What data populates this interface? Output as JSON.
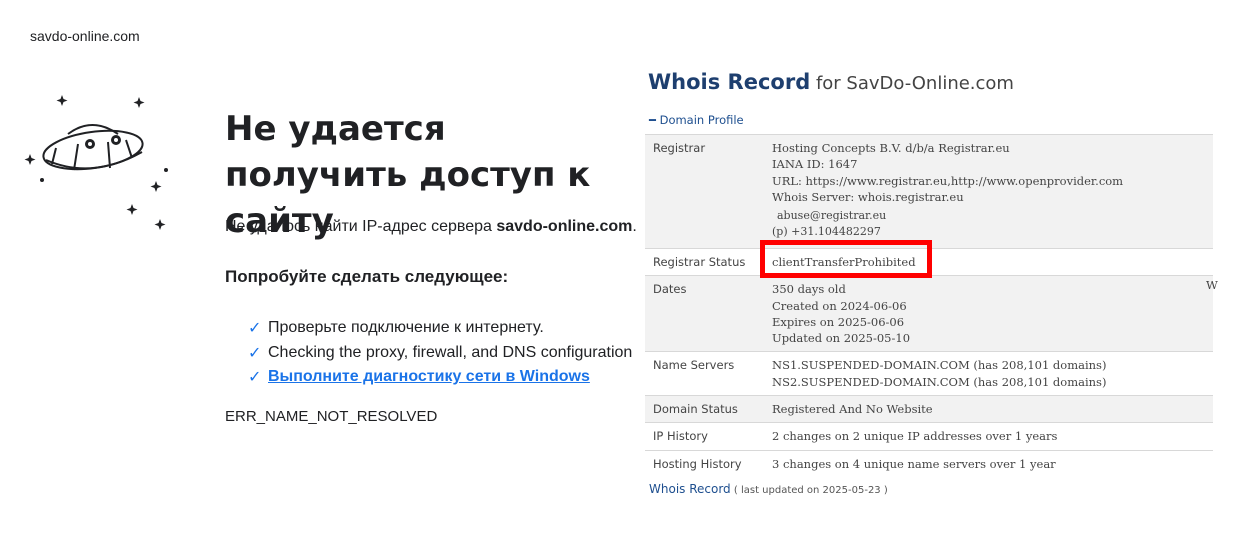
{
  "tab": {
    "title": "savdo-online.com"
  },
  "error_page": {
    "heading": "Не удается получить доступ к сайту",
    "description_prefix": "Не удалось найти IP-адрес сервера ",
    "description_domain": "savdo-online.com",
    "description_suffix": ".",
    "try_heading": "Попробуйте сделать следующее:",
    "suggestions": [
      {
        "text": "Проверьте подключение к интернету."
      },
      {
        "text": "Checking the proxy, firewall, and DNS configuration"
      },
      {
        "text": "Выполните диагностику сети в Windows",
        "link": true
      }
    ],
    "error_code": "ERR_NAME_NOT_RESOLVED",
    "icon": "dino-ufo-icon"
  },
  "whois": {
    "title_main": "Whois Record",
    "title_for": " for SavDo-Online.com",
    "section_toggle": "Domain Profile",
    "rows": {
      "registrar": {
        "label": "Registrar",
        "lines": [
          "Hosting Concepts B.V. d/b/a Registrar.eu",
          "IANA ID: 1647",
          "URL: https://www.registrar.eu,http://www.openprovider.com",
          "Whois Server: whois.registrar.eu"
        ],
        "abuse": "abuse@registrar.eu",
        "phone": "(p) +31.104482297"
      },
      "registrar_status": {
        "label": "Registrar Status",
        "value": "clientTransferProhibited"
      },
      "dates": {
        "label": "Dates",
        "lines": [
          "350 days old",
          "Created on 2024-06-06",
          "Expires on 2025-06-06",
          "Updated on 2025-05-10"
        ],
        "clipped": "W"
      },
      "name_servers": {
        "label": "Name Servers",
        "lines": [
          "NS1.SUSPENDED-DOMAIN.COM (has 208,101 domains)",
          "NS2.SUSPENDED-DOMAIN.COM (has 208,101 domains)"
        ]
      },
      "domain_status": {
        "label": "Domain Status",
        "value": "Registered And No Website"
      },
      "ip_history": {
        "label": "IP History",
        "value": "2 changes on 2 unique IP addresses over 1 years"
      },
      "hosting_history": {
        "label": "Hosting History",
        "value": "3 changes on 4 unique name servers over 1 year"
      }
    },
    "footer_link": "Whois Record",
    "footer_updated": " ( last updated on 2025-05-23 )",
    "highlight_color": "#ff0000"
  }
}
